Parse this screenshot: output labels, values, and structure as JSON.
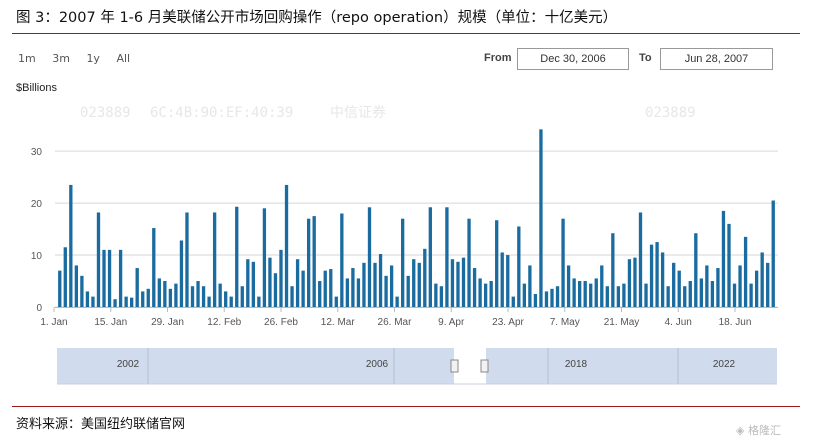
{
  "title": "图 3：2007 年 1-6 月美联储公开市场回购操作（repo operation）规模（单位：十亿美元）",
  "source": "资料来源：美国纽约联储官网",
  "brand_logo_text": "格隆汇",
  "zoom_buttons": [
    "1m",
    "3m",
    "1y",
    "All"
  ],
  "range": {
    "from_label": "From",
    "from_value": "Dec 30, 2006",
    "to_label": "To",
    "to_value": "Jun 28, 2007"
  },
  "navigator_labels": [
    "2002",
    "2006",
    "2018",
    "2022"
  ],
  "colors": {
    "bar": "#1a6ca0",
    "navigator": "#d0dbed",
    "rule": "#a01818"
  },
  "chart_data": {
    "type": "bar",
    "ylabel": "$Billions",
    "ylim": [
      0,
      36
    ],
    "yticks": [
      0,
      10,
      20,
      30
    ],
    "grid": true,
    "x_tick_labels": [
      "1. Jan",
      "15. Jan",
      "29. Jan",
      "12. Feb",
      "26. Feb",
      "12. Mar",
      "26. Mar",
      "9. Apr",
      "23. Apr",
      "7. May",
      "21. May",
      "4. Jun",
      "18. Jun"
    ],
    "values": [
      7,
      11.5,
      23.5,
      8,
      6,
      3,
      2,
      18.2,
      11,
      11,
      1.5,
      11,
      2,
      1.8,
      7.5,
      3,
      3.5,
      15.2,
      5.5,
      5,
      3.5,
      4.5,
      12.8,
      18.2,
      4,
      5,
      4,
      2,
      18.2,
      4.5,
      3,
      2,
      19.3,
      4,
      9.2,
      8.7,
      2,
      19,
      9.5,
      6.5,
      11,
      23.5,
      4,
      9.2,
      7,
      17,
      17.5,
      5,
      7,
      7.3,
      2,
      18,
      5.5,
      7.5,
      5.5,
      8.5,
      19.2,
      8.5,
      10.2,
      6,
      8,
      2,
      17,
      6,
      9.2,
      8.5,
      11.2,
      19.2,
      4.5,
      4,
      19.2,
      9.2,
      8.7,
      9.5,
      17,
      7.5,
      5.5,
      4.5,
      5,
      16.7,
      10.5,
      10,
      2,
      15.5,
      4.5,
      8,
      2.5,
      34.2,
      3,
      3.5,
      4,
      17,
      8,
      5.5,
      5,
      5,
      4.5,
      5.5,
      8,
      4,
      14.2,
      4,
      4.5,
      9.2,
      9.5,
      18.2,
      4.5,
      12,
      12.5,
      10.5,
      4,
      8.5,
      7,
      4,
      5,
      14.2,
      5.5,
      8,
      5,
      7.5,
      18.5,
      16,
      4.5,
      8,
      13.5,
      4.5,
      7,
      10.5,
      8.5,
      20.5
    ]
  },
  "watermark_texts": [
    "023889",
    "6C:4B:90:EF:40:39",
    "中信证券"
  ]
}
